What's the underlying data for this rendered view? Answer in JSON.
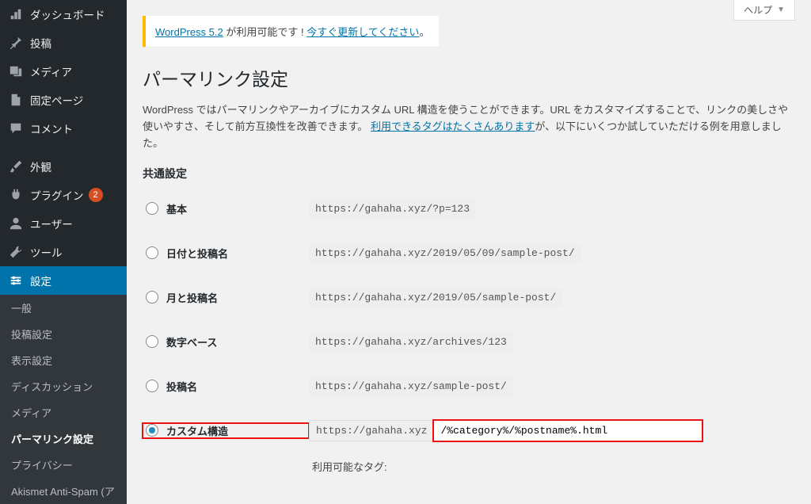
{
  "sidebar": {
    "items": [
      {
        "label": "ダッシュボード",
        "icon": "dashboard"
      },
      {
        "label": "投稿",
        "icon": "pin"
      },
      {
        "label": "メディア",
        "icon": "media"
      },
      {
        "label": "固定ページ",
        "icon": "page"
      },
      {
        "label": "コメント",
        "icon": "comment"
      },
      {
        "label": "外観",
        "icon": "brush"
      },
      {
        "label": "プラグイン",
        "icon": "plugin",
        "badge": "2"
      },
      {
        "label": "ユーザー",
        "icon": "user"
      },
      {
        "label": "ツール",
        "icon": "tools"
      },
      {
        "label": "設定",
        "icon": "settings",
        "active": true
      }
    ],
    "sub": [
      {
        "label": "一般"
      },
      {
        "label": "投稿設定"
      },
      {
        "label": "表示設定"
      },
      {
        "label": "ディスカッション"
      },
      {
        "label": "メディア"
      },
      {
        "label": "パーマリンク設定",
        "current": true
      },
      {
        "label": "プライバシー"
      },
      {
        "label": "Akismet Anti-Spam (ア"
      }
    ]
  },
  "header": {
    "help_label": "ヘルプ"
  },
  "notice": {
    "prefix_link": "WordPress 5.2",
    "mid": " が利用可能です ! ",
    "update_link": "今すぐ更新してください",
    "suffix": "。"
  },
  "page": {
    "title": "パーマリンク設定",
    "desc_1": "WordPress ではパーマリンクやアーカイブにカスタム URL 構造を使うことができます。URL をカスタマイズすることで、リンクの美しさや使いやすさ、そして前方互換性を改善できます。",
    "desc_link": "利用できるタグはたくさんあります",
    "desc_2": "が、以下にいくつか試していただける例を用意しました。",
    "common_title": "共通設定",
    "available_tags_label": "利用可能なタグ:"
  },
  "options": [
    {
      "key": "plain",
      "label": "基本",
      "example": "https://gahaha.xyz/?p=123"
    },
    {
      "key": "dayname",
      "label": "日付と投稿名",
      "example": "https://gahaha.xyz/2019/05/09/sample-post/"
    },
    {
      "key": "monthname",
      "label": "月と投稿名",
      "example": "https://gahaha.xyz/2019/05/sample-post/"
    },
    {
      "key": "numeric",
      "label": "数字ベース",
      "example": "https://gahaha.xyz/archives/123"
    },
    {
      "key": "postname",
      "label": "投稿名",
      "example": "https://gahaha.xyz/sample-post/"
    },
    {
      "key": "custom",
      "label": "カスタム構造",
      "prefix": "https://gahaha.xyz",
      "value": "/%category%/%postname%.html",
      "checked": true
    }
  ]
}
